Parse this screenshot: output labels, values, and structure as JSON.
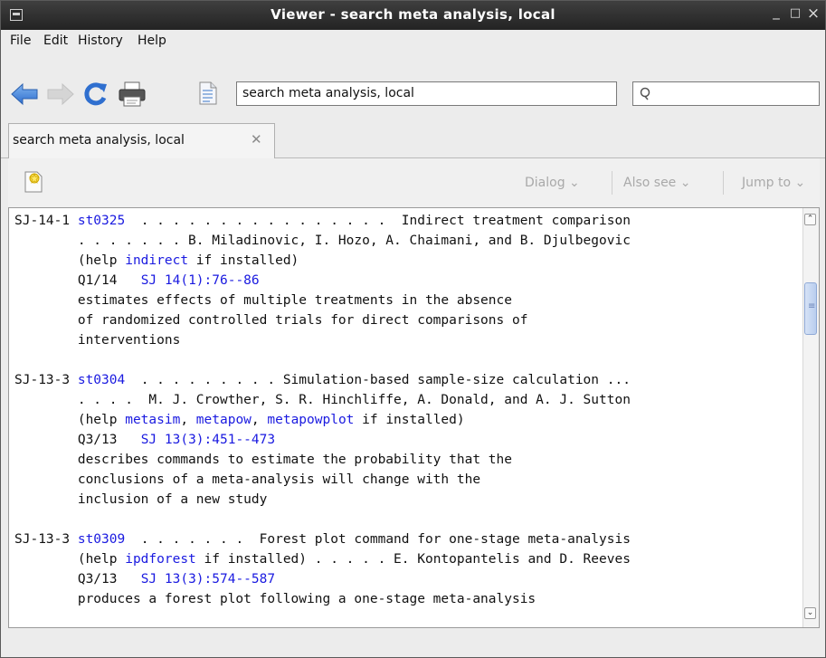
{
  "window": {
    "title": "Viewer - search meta analysis, local",
    "minimize": "_",
    "maximize": "□",
    "close": "×"
  },
  "menu": [
    "File",
    "Edit",
    "History",
    "Help"
  ],
  "toolbar": {
    "url_value": "search meta analysis, local",
    "search_placeholder": "",
    "search_icon": "search-icon"
  },
  "tab": {
    "label": "search meta analysis, local",
    "close": "✕"
  },
  "subtoolbar": {
    "dialog": "Dialog",
    "also_see": "Also see",
    "jump_to": "Jump to"
  },
  "entries": [
    {
      "id": "SJ-14-1",
      "code": "st0325",
      "lines": [
        {
          "segs": [
            {
              "t": "SJ-14-1 "
            },
            {
              "t": "st0325",
              "link": true
            },
            {
              "t": "  . . . . . . . . . . . . . . . .  Indirect treatment comparison"
            }
          ]
        },
        {
          "segs": [
            {
              "t": "        . . . . . . . B. Miladinovic, I. Hozo, A. Chaimani, and B. Djulbegovic"
            }
          ]
        },
        {
          "segs": [
            {
              "t": "        (help "
            },
            {
              "t": "indirect",
              "link": true
            },
            {
              "t": " if installed)"
            }
          ]
        },
        {
          "segs": [
            {
              "t": "        Q1/14   "
            },
            {
              "t": "SJ 14(1):76--86",
              "link": true
            }
          ]
        },
        {
          "segs": [
            {
              "t": "        estimates effects of multiple treatments in the absence"
            }
          ]
        },
        {
          "segs": [
            {
              "t": "        of randomized controlled trials for direct comparisons of"
            }
          ]
        },
        {
          "segs": [
            {
              "t": "        interventions"
            }
          ]
        }
      ]
    },
    {
      "id": "SJ-13-3",
      "code": "st0304",
      "lines": [
        {
          "segs": [
            {
              "t": "SJ-13-3 "
            },
            {
              "t": "st0304",
              "link": true
            },
            {
              "t": "  . . . . . . . . . Simulation-based sample-size calculation ..."
            }
          ]
        },
        {
          "segs": [
            {
              "t": "        . . . .  M. J. Crowther, S. R. Hinchliffe, A. Donald, and A. J. Sutton"
            }
          ]
        },
        {
          "segs": [
            {
              "t": "        (help "
            },
            {
              "t": "metasim",
              "link": true
            },
            {
              "t": ", "
            },
            {
              "t": "metapow",
              "link": true
            },
            {
              "t": ", "
            },
            {
              "t": "metapowplot",
              "link": true
            },
            {
              "t": " if installed)"
            }
          ]
        },
        {
          "segs": [
            {
              "t": "        Q3/13   "
            },
            {
              "t": "SJ 13(3):451--473",
              "link": true
            }
          ]
        },
        {
          "segs": [
            {
              "t": "        describes commands to estimate the probability that the"
            }
          ]
        },
        {
          "segs": [
            {
              "t": "        conclusions of a meta-analysis will change with the"
            }
          ]
        },
        {
          "segs": [
            {
              "t": "        inclusion of a new study"
            }
          ]
        }
      ]
    },
    {
      "id": "SJ-13-3",
      "code": "st0309",
      "lines": [
        {
          "segs": [
            {
              "t": "SJ-13-3 "
            },
            {
              "t": "st0309",
              "link": true
            },
            {
              "t": "  . . . . . . .  Forest plot command for one-stage meta-analysis"
            }
          ]
        },
        {
          "segs": [
            {
              "t": "        (help "
            },
            {
              "t": "ipdforest",
              "link": true
            },
            {
              "t": " if installed) . . . . . E. Kontopantelis and D. Reeves"
            }
          ]
        },
        {
          "segs": [
            {
              "t": "        Q3/13   "
            },
            {
              "t": "SJ 13(3):574--587",
              "link": true
            }
          ]
        },
        {
          "segs": [
            {
              "t": "        produces a forest plot following a one-stage meta-analysis"
            }
          ]
        }
      ]
    }
  ]
}
